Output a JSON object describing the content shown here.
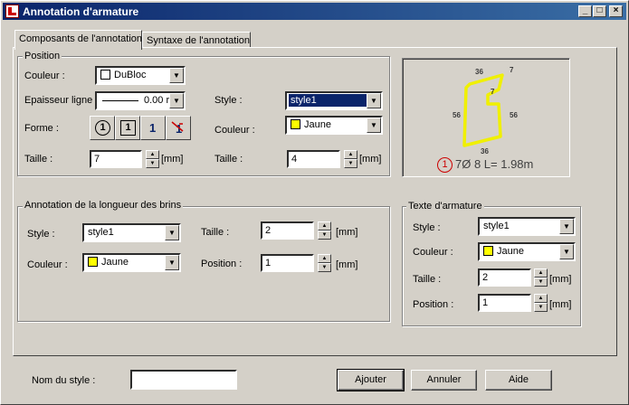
{
  "window": {
    "title": "Annotation d'armature",
    "minimize_icon": "minimize-icon",
    "maximize_icon": "maximize-icon",
    "close_icon": "close-icon"
  },
  "tabs": [
    {
      "label": "Composants de l'annotation",
      "active": true
    },
    {
      "label": "Syntaxe de l'annotation",
      "active": false
    }
  ],
  "position": {
    "legend": "Position",
    "couleur_label": "Couleur :",
    "couleur_value": "DuBloc",
    "couleur_swatch": "#ffffff",
    "epaisseur_label": "Epaisseur ligne :",
    "epaisseur_value": "0.00 r",
    "forme_label": "Forme :",
    "forme_buttons": [
      "1",
      "1",
      "1",
      "1"
    ],
    "taille_label": "Taille :",
    "taille_value": "7",
    "taille_unit": "[mm]",
    "style_label": "Style :",
    "style_value": "style1",
    "couleur2_label": "Couleur :",
    "couleur2_value": "Jaune",
    "couleur2_swatch": "#ffff00",
    "taille2_label": "Taille :",
    "taille2_value": "4",
    "taille2_unit": "[mm]"
  },
  "preview": {
    "dims": [
      "36",
      "7",
      "7",
      "56",
      "56",
      "36"
    ],
    "annotation_number": "1",
    "annotation_text": "7Ø 8 L= 1.98m",
    "shape_color": "#f0f000"
  },
  "brins": {
    "legend": "Annotation de la longueur des brins",
    "style_label": "Style :",
    "style_value": "style1",
    "couleur_label": "Couleur :",
    "couleur_value": "Jaune",
    "couleur_swatch": "#ffff00",
    "taille_label": "Taille :",
    "taille_value": "2",
    "taille_unit": "[mm]",
    "position_label": "Position :",
    "position_value": "1",
    "position_unit": "[mm]"
  },
  "texte": {
    "legend": "Texte d'armature",
    "style_label": "Style :",
    "style_value": "style1",
    "couleur_label": "Couleur :",
    "couleur_value": "Jaune",
    "couleur_swatch": "#ffff00",
    "taille_label": "Taille :",
    "taille_value": "2",
    "taille_unit": "[mm]",
    "position_label": "Position :",
    "position_value": "1",
    "position_unit": "[mm]"
  },
  "footer": {
    "nom_label": "Nom du style :",
    "nom_value": "",
    "ajouter": "Ajouter",
    "annuler": "Annuler",
    "aide": "Aide"
  }
}
